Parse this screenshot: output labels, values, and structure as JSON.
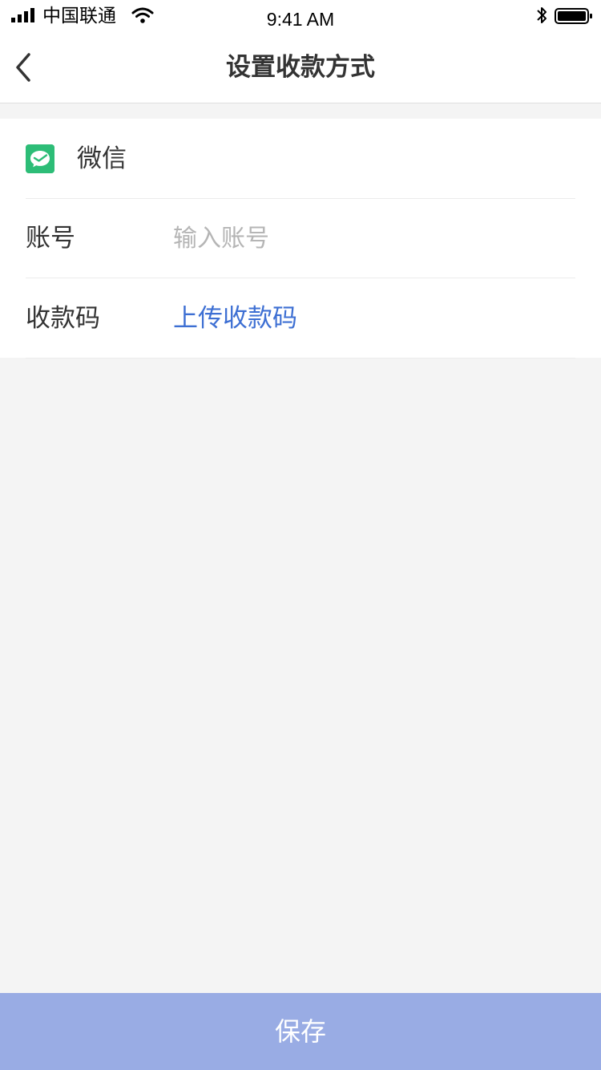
{
  "status_bar": {
    "carrier": "中国联通",
    "time": "9:41 AM",
    "icons": [
      "signal-icon",
      "wifi-icon",
      "bluetooth-icon",
      "battery-icon"
    ]
  },
  "nav": {
    "title": "设置收款方式",
    "back_icon": "chevron-left-icon"
  },
  "form": {
    "method": {
      "icon": "wechat-icon",
      "name": "微信"
    },
    "account": {
      "label": "账号",
      "value": "",
      "placeholder": "输入账号"
    },
    "qr_code": {
      "label": "收款码",
      "action": "上传收款码"
    }
  },
  "save_button": {
    "label": "保存"
  },
  "colors": {
    "accent": "#3d6fd3",
    "save_button_bg": "#99ace4",
    "wechat_green": "#2dbd77",
    "page_bg": "#f4f4f4"
  }
}
